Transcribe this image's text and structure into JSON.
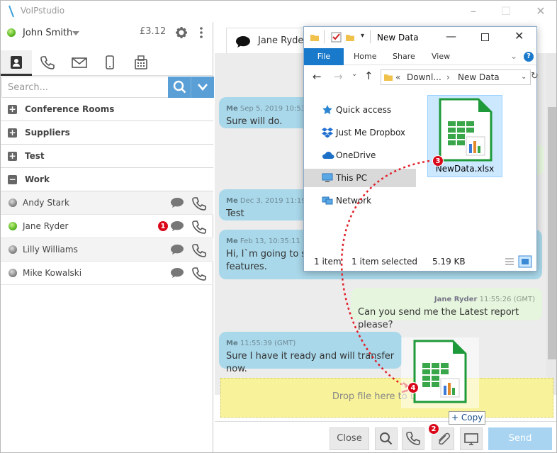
{
  "app": {
    "title": "VoIPstudio"
  },
  "user": {
    "name": "John Smith",
    "balance": "£3.12"
  },
  "search": {
    "placeholder": "Search..."
  },
  "groups": [
    {
      "label": "Conference Rooms",
      "state": "+"
    },
    {
      "label": "Suppliers",
      "state": "+"
    },
    {
      "label": "Test",
      "state": "+"
    },
    {
      "label": "Work",
      "state": "−"
    }
  ],
  "contacts": [
    {
      "name": "Andy Stark",
      "status": "offline"
    },
    {
      "name": "Jane Ryder",
      "status": "online",
      "unread": "1"
    },
    {
      "name": "Lilly Williams",
      "status": "offline"
    },
    {
      "name": "Mike Kowalski",
      "status": "offline"
    }
  ],
  "chat": {
    "contact_name": "Jane Ryder",
    "messages": [
      {
        "sender": "Me",
        "time": "Sep 5, 2019 10:53",
        "text": "Sure will do."
      },
      {
        "sender": "Me",
        "time": "Dec 3, 2019 11:19",
        "text": "Test"
      },
      {
        "sender": "Me",
        "time": "Feb 13, 10:35:11",
        "text1": "Hi, I`m going to sta",
        "text2": "features."
      },
      {
        "sender": "Jane Ryder",
        "time": "11:55:26 (GMT)",
        "text": "Can you send me the Latest report please?"
      },
      {
        "sender": "Me",
        "time": "11:55:39 (GMT)",
        "text": "Sure I have it ready and will transfer now."
      }
    ],
    "drop_text": "Drop file here to upload",
    "close_label": "Close",
    "send_label": "Send"
  },
  "explorer": {
    "title": "New Data",
    "ribbon": {
      "file": "File",
      "home": "Home",
      "share": "Share",
      "view": "View"
    },
    "address": {
      "part1": "Downl...",
      "part2": "New Data"
    },
    "nav": [
      "Quick access",
      "Just Me Dropbox",
      "OneDrive",
      "This PC",
      "Network"
    ],
    "file_name": "NewData.xlsx",
    "status": {
      "count": "1 item",
      "selected": "1 item selected",
      "size": "5.19 KB"
    }
  },
  "drag": {
    "copy_label": "Copy"
  },
  "steps": [
    "1",
    "2",
    "3",
    "4"
  ],
  "colors": {
    "accent": "#5a9fd6",
    "my_bubble": "#a9d8ea",
    "their_bubble": "#e6f5dd",
    "drop_zone": "#f8f29a",
    "badge": "#d9091a",
    "drag_path": "#e0202a"
  }
}
